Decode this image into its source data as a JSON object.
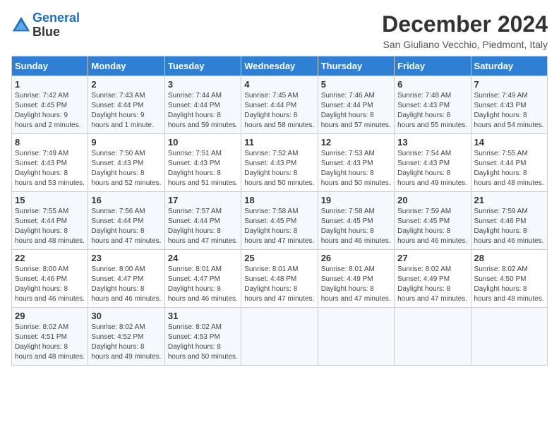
{
  "header": {
    "logo_line1": "General",
    "logo_line2": "Blue",
    "month_year": "December 2024",
    "location": "San Giuliano Vecchio, Piedmont, Italy"
  },
  "weekdays": [
    "Sunday",
    "Monday",
    "Tuesday",
    "Wednesday",
    "Thursday",
    "Friday",
    "Saturday"
  ],
  "weeks": [
    [
      {
        "day": "1",
        "sunrise": "7:42 AM",
        "sunset": "4:45 PM",
        "daylight": "9 hours and 2 minutes."
      },
      {
        "day": "2",
        "sunrise": "7:43 AM",
        "sunset": "4:44 PM",
        "daylight": "9 hours and 1 minute."
      },
      {
        "day": "3",
        "sunrise": "7:44 AM",
        "sunset": "4:44 PM",
        "daylight": "8 hours and 59 minutes."
      },
      {
        "day": "4",
        "sunrise": "7:45 AM",
        "sunset": "4:44 PM",
        "daylight": "8 hours and 58 minutes."
      },
      {
        "day": "5",
        "sunrise": "7:46 AM",
        "sunset": "4:44 PM",
        "daylight": "8 hours and 57 minutes."
      },
      {
        "day": "6",
        "sunrise": "7:48 AM",
        "sunset": "4:43 PM",
        "daylight": "8 hours and 55 minutes."
      },
      {
        "day": "7",
        "sunrise": "7:49 AM",
        "sunset": "4:43 PM",
        "daylight": "8 hours and 54 minutes."
      }
    ],
    [
      {
        "day": "8",
        "sunrise": "7:49 AM",
        "sunset": "4:43 PM",
        "daylight": "8 hours and 53 minutes."
      },
      {
        "day": "9",
        "sunrise": "7:50 AM",
        "sunset": "4:43 PM",
        "daylight": "8 hours and 52 minutes."
      },
      {
        "day": "10",
        "sunrise": "7:51 AM",
        "sunset": "4:43 PM",
        "daylight": "8 hours and 51 minutes."
      },
      {
        "day": "11",
        "sunrise": "7:52 AM",
        "sunset": "4:43 PM",
        "daylight": "8 hours and 50 minutes."
      },
      {
        "day": "12",
        "sunrise": "7:53 AM",
        "sunset": "4:43 PM",
        "daylight": "8 hours and 50 minutes."
      },
      {
        "day": "13",
        "sunrise": "7:54 AM",
        "sunset": "4:43 PM",
        "daylight": "8 hours and 49 minutes."
      },
      {
        "day": "14",
        "sunrise": "7:55 AM",
        "sunset": "4:44 PM",
        "daylight": "8 hours and 48 minutes."
      }
    ],
    [
      {
        "day": "15",
        "sunrise": "7:55 AM",
        "sunset": "4:44 PM",
        "daylight": "8 hours and 48 minutes."
      },
      {
        "day": "16",
        "sunrise": "7:56 AM",
        "sunset": "4:44 PM",
        "daylight": "8 hours and 47 minutes."
      },
      {
        "day": "17",
        "sunrise": "7:57 AM",
        "sunset": "4:44 PM",
        "daylight": "8 hours and 47 minutes."
      },
      {
        "day": "18",
        "sunrise": "7:58 AM",
        "sunset": "4:45 PM",
        "daylight": "8 hours and 47 minutes."
      },
      {
        "day": "19",
        "sunrise": "7:58 AM",
        "sunset": "4:45 PM",
        "daylight": "8 hours and 46 minutes."
      },
      {
        "day": "20",
        "sunrise": "7:59 AM",
        "sunset": "4:45 PM",
        "daylight": "8 hours and 46 minutes."
      },
      {
        "day": "21",
        "sunrise": "7:59 AM",
        "sunset": "4:46 PM",
        "daylight": "8 hours and 46 minutes."
      }
    ],
    [
      {
        "day": "22",
        "sunrise": "8:00 AM",
        "sunset": "4:46 PM",
        "daylight": "8 hours and 46 minutes."
      },
      {
        "day": "23",
        "sunrise": "8:00 AM",
        "sunset": "4:47 PM",
        "daylight": "8 hours and 46 minutes."
      },
      {
        "day": "24",
        "sunrise": "8:01 AM",
        "sunset": "4:47 PM",
        "daylight": "8 hours and 46 minutes."
      },
      {
        "day": "25",
        "sunrise": "8:01 AM",
        "sunset": "4:48 PM",
        "daylight": "8 hours and 47 minutes."
      },
      {
        "day": "26",
        "sunrise": "8:01 AM",
        "sunset": "4:49 PM",
        "daylight": "8 hours and 47 minutes."
      },
      {
        "day": "27",
        "sunrise": "8:02 AM",
        "sunset": "4:49 PM",
        "daylight": "8 hours and 47 minutes."
      },
      {
        "day": "28",
        "sunrise": "8:02 AM",
        "sunset": "4:50 PM",
        "daylight": "8 hours and 48 minutes."
      }
    ],
    [
      {
        "day": "29",
        "sunrise": "8:02 AM",
        "sunset": "4:51 PM",
        "daylight": "8 hours and 48 minutes."
      },
      {
        "day": "30",
        "sunrise": "8:02 AM",
        "sunset": "4:52 PM",
        "daylight": "8 hours and 49 minutes."
      },
      {
        "day": "31",
        "sunrise": "8:02 AM",
        "sunset": "4:53 PM",
        "daylight": "8 hours and 50 minutes."
      },
      null,
      null,
      null,
      null
    ]
  ]
}
